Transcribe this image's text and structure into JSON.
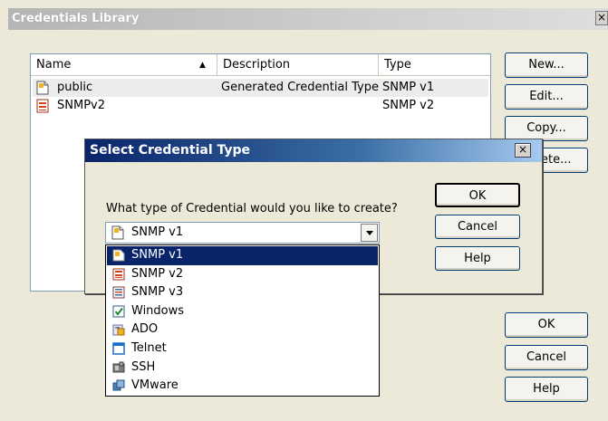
{
  "main_window": {
    "title": "Credentials Library",
    "close_glyph": "×",
    "columns": [
      "Name",
      "Description",
      "Type"
    ],
    "sort_indicator": "▲",
    "rows": [
      {
        "name": "public",
        "description": "Generated Credential Type",
        "type": "SNMP v1",
        "icon": "snmp-v1-icon"
      },
      {
        "name": "SNMPv2",
        "description": "",
        "type": "SNMP v2",
        "icon": "snmp-v2-icon"
      }
    ],
    "side_buttons": {
      "new": "New...",
      "edit": "Edit...",
      "copy": "Copy...",
      "delete": "Delete..."
    },
    "bottom_buttons": {
      "ok": "OK",
      "cancel": "Cancel",
      "help": "Help"
    }
  },
  "dialog": {
    "title": "Select Credential Type",
    "close_glyph": "×",
    "question": "What type of Credential would you like to create?",
    "selected_value": "SNMP v1",
    "buttons": {
      "ok": "OK",
      "cancel": "Cancel",
      "help": "Help"
    },
    "options": [
      {
        "label": "SNMP v1",
        "icon": "snmp-v1-icon",
        "selected": true
      },
      {
        "label": "SNMP v2",
        "icon": "snmp-v2-icon",
        "selected": false
      },
      {
        "label": "SNMP v3",
        "icon": "snmp-v3-icon",
        "selected": false
      },
      {
        "label": "Windows",
        "icon": "windows-check-icon",
        "selected": false
      },
      {
        "label": "ADO",
        "icon": "ado-icon",
        "selected": false
      },
      {
        "label": "Telnet",
        "icon": "telnet-icon",
        "selected": false
      },
      {
        "label": "SSH",
        "icon": "ssh-icon",
        "selected": false
      },
      {
        "label": "VMware",
        "icon": "vmware-icon",
        "selected": false
      }
    ]
  },
  "colors": {
    "dialog_title_start": "#0a246a",
    "dialog_title_end": "#a6caf0",
    "selection": "#0a246a",
    "face": "#ece9d8"
  }
}
